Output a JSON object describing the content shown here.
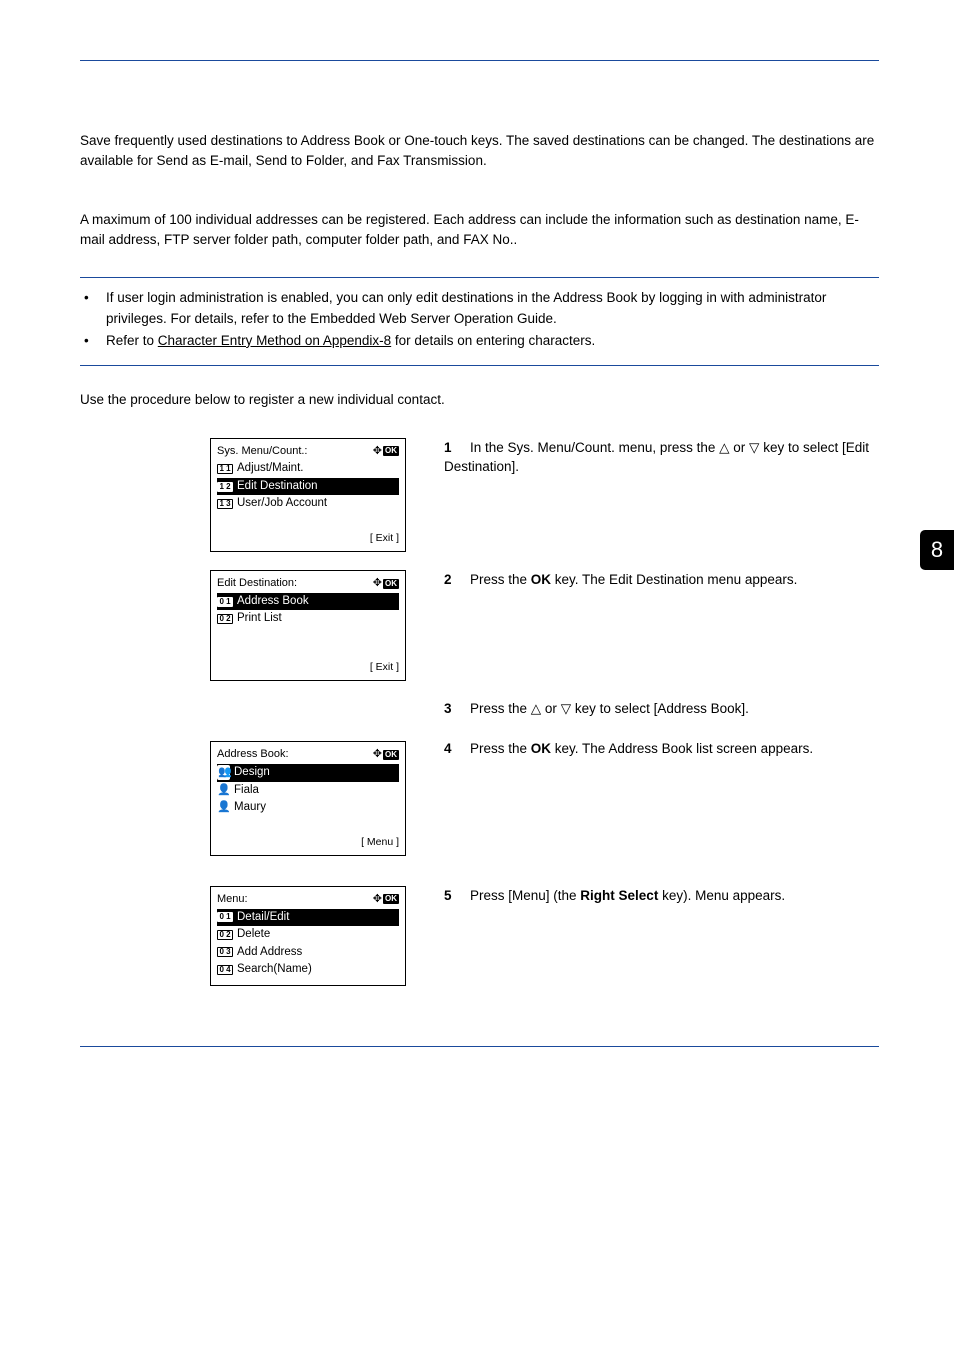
{
  "intro": "Save frequently used destinations to Address Book or One-touch keys. The saved destinations can be changed. The destinations are available for Send as E-mail, Send to Folder, and Fax Transmission.",
  "limit": "A maximum of 100 individual addresses can be registered. Each address can include the information such as destination name, E-mail address, FTP server folder path, computer folder path, and FAX No..",
  "note1a": "If user login administration is enabled, you can only edit destinations in the Address Book by logging in with administrator privileges. For details, refer to the Embedded Web Server Operation Guide.",
  "note2a": "Refer to ",
  "note2link": "Character Entry Method on Appendix-8",
  "note2b": " for details on entering characters.",
  "proc": "Use the procedure below to register a new individual contact.",
  "tab": "8",
  "step1": {
    "num": "1",
    "a": "In the Sys. Menu/Count. menu, press the ",
    "b": " or ",
    "c": " key to select [Edit Destination]."
  },
  "step2": {
    "num": "2",
    "a": "Press the ",
    "b": " key. The Edit Destination menu appears."
  },
  "step3": {
    "num": "3",
    "a": "Press the ",
    "b": " or ",
    "c": " key to select [Address Book]."
  },
  "step4": {
    "num": "4",
    "a": "Press the ",
    "b": " key. The Address Book list screen appears."
  },
  "step5": {
    "num": "5",
    "a": "Press [Menu] (the ",
    "b": " key). Menu appears."
  },
  "lcd1": {
    "title": "Sys. Menu/Count.:",
    "r1": {
      "badge": "1 1",
      "text": " Adjust/Maint."
    },
    "r2": {
      "badge": "1 2",
      "text": " Edit Destination"
    },
    "r3": {
      "badge": "1 3",
      "text": " User/Job Account"
    },
    "footL": "",
    "footR": "[ Exit  ]"
  },
  "lcd2": {
    "title": "Edit Destination:",
    "r1": {
      "badge": "0 1",
      "text": " Address Book"
    },
    "r2": {
      "badge": "0 2",
      "text": " Print List"
    },
    "footL": "",
    "footR": "[ Exit  ]"
  },
  "lcd3": {
    "title": "Address Book:",
    "r1": {
      "text": " Design"
    },
    "r2": {
      "text": " Fiala"
    },
    "r3": {
      "text": " Maury"
    },
    "footL": "",
    "footR": "[ Menu ]"
  },
  "lcd4": {
    "title": "Menu:",
    "r1": {
      "badge": "0 1",
      "text": " Detail/Edit"
    },
    "r2": {
      "badge": "0 2",
      "text": " Delete"
    },
    "r3": {
      "badge": "0 3",
      "text": " Add Address"
    },
    "r4": {
      "badge": "0 4",
      "text": " Search(Name)"
    }
  },
  "arrows": {
    "up": "△",
    "down": "▽",
    "nav": "✥"
  },
  "ok": "OK"
}
